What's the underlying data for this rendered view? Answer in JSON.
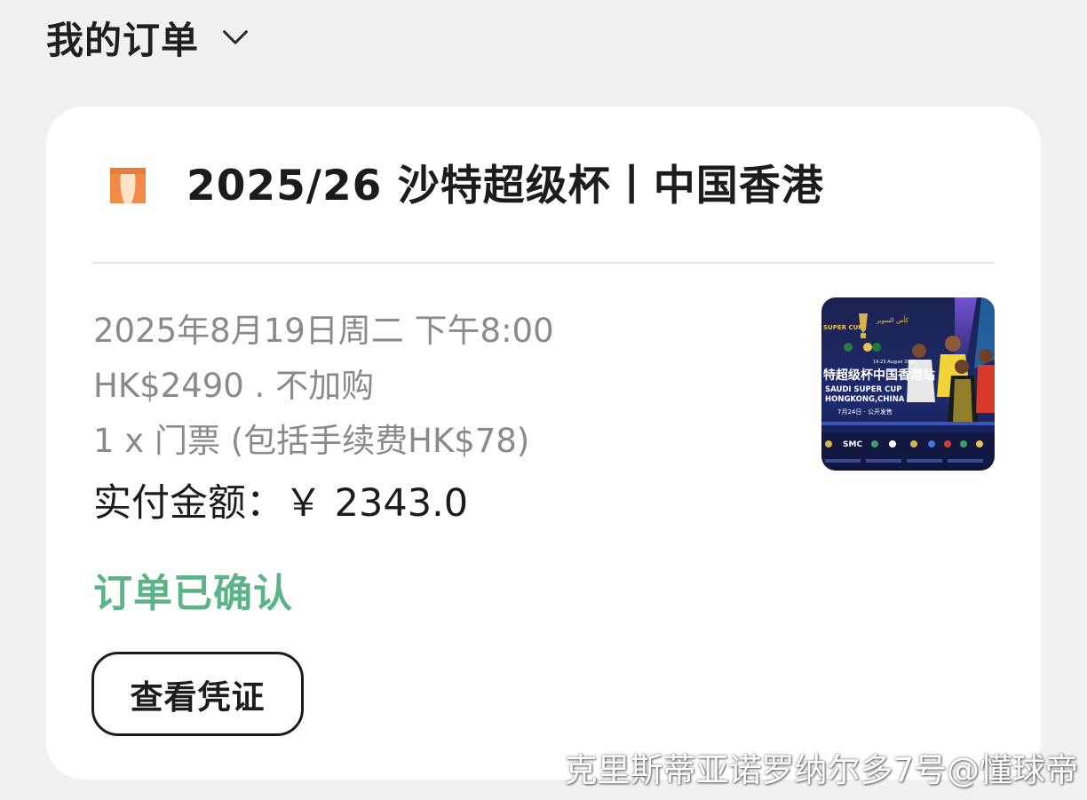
{
  "header": {
    "title": "我的订单",
    "dropdown_icon": "chevron-down-icon"
  },
  "order": {
    "venue_icon": "theater-curtain-icon",
    "event_title": "2025/26 沙特超级杯丨中国香港",
    "datetime": "2025年8月19日周二 下午8:00",
    "price_line": "HK$2490 . 不加购",
    "ticket_line": "1 x 门票 (包括手续费HK$78)",
    "paid_label": "实付金额：",
    "paid_amount": "￥ 2343.0",
    "status": "订单已确认",
    "status_color": "#5bb388",
    "view_voucher_label": "查看凭证",
    "poster": {
      "title_cn": "特超级杯中国香港站",
      "title_en_1": "SAUDI SUPER CUP",
      "title_en_2": "HONGKONG,CHINA",
      "date_text": "19-23 August 2025",
      "sale_text": "7月24日 · 公开发售",
      "cup_label": "SUPER CUP",
      "sponsor": "SMC"
    }
  },
  "watermark": "克里斯蒂亚诺罗纳尔多7号@懂球帝"
}
